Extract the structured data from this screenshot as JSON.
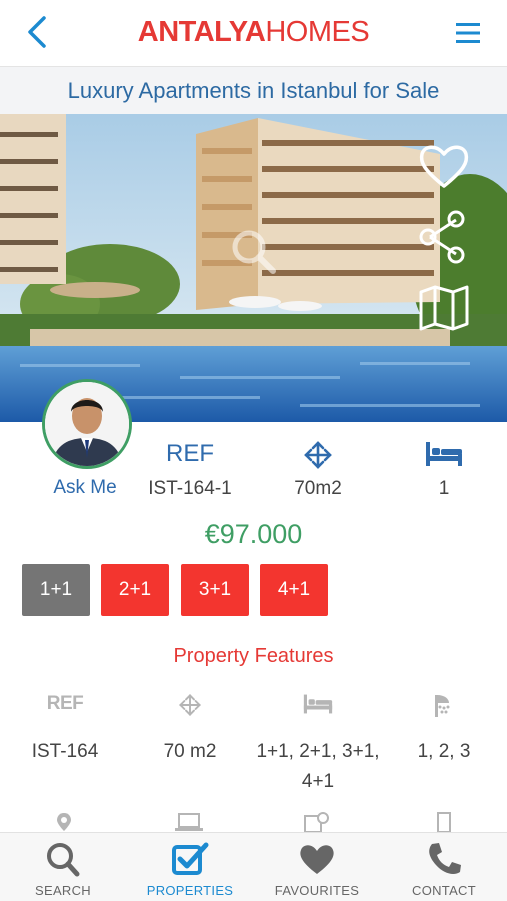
{
  "header": {
    "back_icon": "chevron-left-icon",
    "logo_bold": "ANTALYA",
    "logo_light": "HOMES",
    "menu_icon": "hamburger-menu-icon",
    "brand_color": "#e53935",
    "accent_color": "#1c8ad0"
  },
  "listing": {
    "title": "Luxury Apartments in Istanbul for Sale",
    "hero_icons": [
      "heart-icon",
      "share-icon",
      "map-icon",
      "zoom-icon"
    ],
    "agent_label": "Ask Me",
    "stats": [
      {
        "header": "REF",
        "value": "IST-164-1"
      },
      {
        "icon": "move-arrows-icon",
        "value": "70m2"
      },
      {
        "icon": "bed-icon",
        "value": "1"
      }
    ],
    "price": "€97.000",
    "room_options": [
      {
        "label": "1+1",
        "selected": true
      },
      {
        "label": "2+1",
        "selected": false
      },
      {
        "label": "3+1",
        "selected": false
      },
      {
        "label": "4+1",
        "selected": false
      }
    ]
  },
  "features": {
    "title": "Property Features",
    "ref_icon_text": "REF",
    "items": [
      {
        "icon": "ref-icon",
        "value": "IST-164"
      },
      {
        "icon": "move-arrows-icon",
        "value": "70 m2"
      },
      {
        "icon": "bed-icon",
        "value": "1+1, 2+1, 3+1,",
        "value2": "4+1"
      },
      {
        "icon": "shower-icon",
        "value": "1, 2, 3"
      }
    ],
    "row2_icons": [
      "location-pin-icon",
      "laptop-icon",
      "calendar-clock-icon",
      "building-icon"
    ]
  },
  "bottom_nav": [
    {
      "label": "SEARCH",
      "icon": "search-icon",
      "active": false
    },
    {
      "label": "PROPERTIES",
      "icon": "checkbox-icon",
      "active": true
    },
    {
      "label": "FAVOURITES",
      "icon": "heart-icon",
      "active": false
    },
    {
      "label": "CONTACT",
      "icon": "phone-icon",
      "active": false
    }
  ]
}
